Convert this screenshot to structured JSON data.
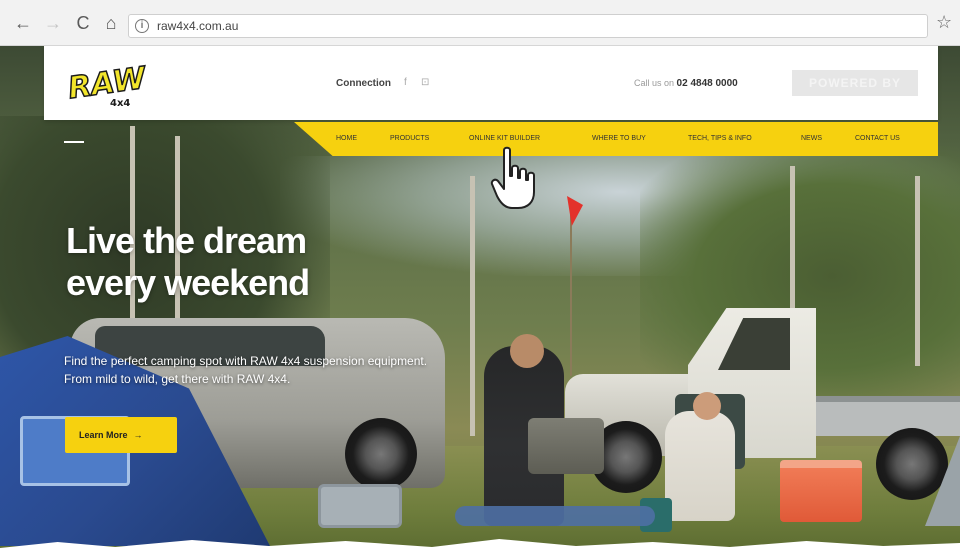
{
  "browser": {
    "url": "raw4x4.com.au",
    "back_icon": "←",
    "forward_icon": "→",
    "reload_icon": "C",
    "home_icon": "⌂",
    "info_icon": "i",
    "star_icon": "☆"
  },
  "header": {
    "logo_text": "RAW",
    "logo_sub": "4x4",
    "connection_label": "Connection",
    "social_icons": [
      "f",
      "⊡"
    ],
    "phone_label": "Call us on",
    "phone_number": "02 4848 0000",
    "badge_text": "POWERED BY"
  },
  "nav": {
    "items": [
      "HOME",
      "PRODUCTS",
      "ONLINE KIT BUILDER",
      "WHERE TO BUY",
      "TECH, TIPS & INFO",
      "NEWS",
      "CONTACT US"
    ]
  },
  "hero": {
    "title_line1": "Live the dream",
    "title_line2": "every weekend",
    "text": "Find the perfect camping spot with RAW 4x4 suspension equipment. From mild to wild, get there with RAW 4x4.",
    "cta_label": "Learn More",
    "cta_arrow": "→"
  },
  "colors": {
    "accent": "#f6d10f",
    "logo_yellow": "#f2e52a",
    "text_dark": "#222222"
  }
}
